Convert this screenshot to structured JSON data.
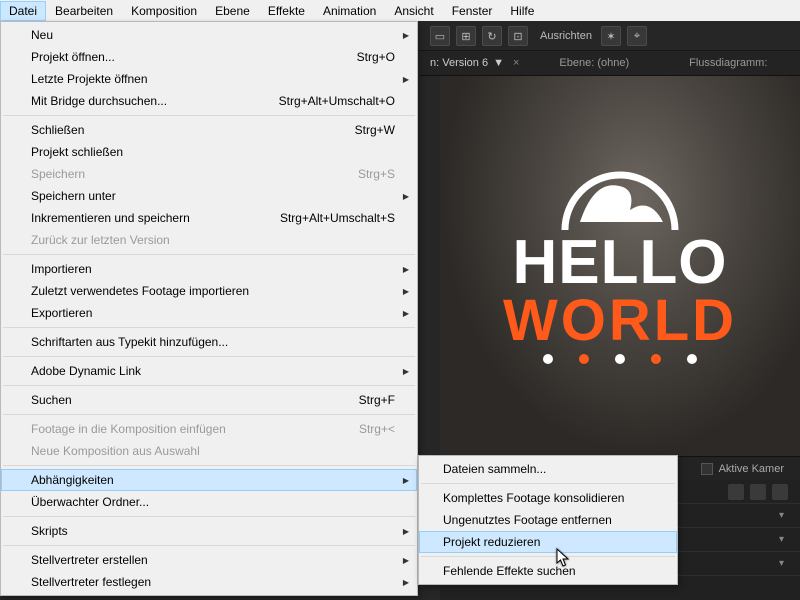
{
  "menubar": {
    "items": [
      "Datei",
      "Bearbeiten",
      "Komposition",
      "Ebene",
      "Effekte",
      "Animation",
      "Ansicht",
      "Fenster",
      "Hilfe"
    ],
    "active_index": 0
  },
  "toolbar": {
    "align_label": "Ausrichten"
  },
  "panel_strip": {
    "tab_label": "n: Version 6",
    "tab_suffix": "▼",
    "layer_label": "Ebene: (ohne)",
    "flow_label": "Flussdiagramm:"
  },
  "preview": {
    "line1": "HELLO",
    "line2": "WORLD"
  },
  "footer": {
    "camera_label": "Aktive Kamer"
  },
  "dropdown": {
    "items": [
      {
        "label": "Neu",
        "shortcut": "",
        "sub": true
      },
      {
        "label": "Projekt öffnen...",
        "shortcut": "Strg+O"
      },
      {
        "label": "Letzte Projekte öffnen",
        "shortcut": "",
        "sub": true
      },
      {
        "label": "Mit Bridge durchsuchen...",
        "shortcut": "Strg+Alt+Umschalt+O"
      },
      {
        "sep": true
      },
      {
        "label": "Schließen",
        "shortcut": "Strg+W"
      },
      {
        "label": "Projekt schließen"
      },
      {
        "label": "Speichern",
        "shortcut": "Strg+S",
        "disabled": true
      },
      {
        "label": "Speichern unter",
        "shortcut": "",
        "sub": true
      },
      {
        "label": "Inkrementieren und speichern",
        "shortcut": "Strg+Alt+Umschalt+S"
      },
      {
        "label": "Zurück zur letzten Version",
        "disabled": true
      },
      {
        "sep": true
      },
      {
        "label": "Importieren",
        "shortcut": "",
        "sub": true
      },
      {
        "label": "Zuletzt verwendetes Footage importieren",
        "shortcut": "",
        "sub": true
      },
      {
        "label": "Exportieren",
        "shortcut": "",
        "sub": true
      },
      {
        "sep": true
      },
      {
        "label": "Schriftarten aus Typekit hinzufügen..."
      },
      {
        "sep": true
      },
      {
        "label": "Adobe Dynamic Link",
        "shortcut": "",
        "sub": true
      },
      {
        "sep": true
      },
      {
        "label": "Suchen",
        "shortcut": "Strg+F"
      },
      {
        "sep": true
      },
      {
        "label": "Footage in die Komposition einfügen",
        "shortcut": "Strg+<",
        "disabled": true
      },
      {
        "label": "Neue Komposition aus Auswahl",
        "disabled": true
      },
      {
        "sep": true
      },
      {
        "label": "Abhängigkeiten",
        "shortcut": "",
        "sub": true,
        "hover": true
      },
      {
        "label": "Überwachter Ordner..."
      },
      {
        "sep": true
      },
      {
        "label": "Skripts",
        "shortcut": "",
        "sub": true
      },
      {
        "sep": true
      },
      {
        "label": "Stellvertreter erstellen",
        "shortcut": "",
        "sub": true
      },
      {
        "label": "Stellvertreter festlegen",
        "shortcut": "",
        "sub": true
      }
    ]
  },
  "submenu": {
    "items": [
      {
        "label": "Dateien sammeln..."
      },
      {
        "sep": true
      },
      {
        "label": "Komplettes Footage konsolidieren"
      },
      {
        "label": "Ungenutztes Footage entfernen"
      },
      {
        "label": "Projekt reduzieren",
        "hover": true
      },
      {
        "sep": true
      },
      {
        "label": "Fehlende Effekte suchen"
      }
    ]
  }
}
